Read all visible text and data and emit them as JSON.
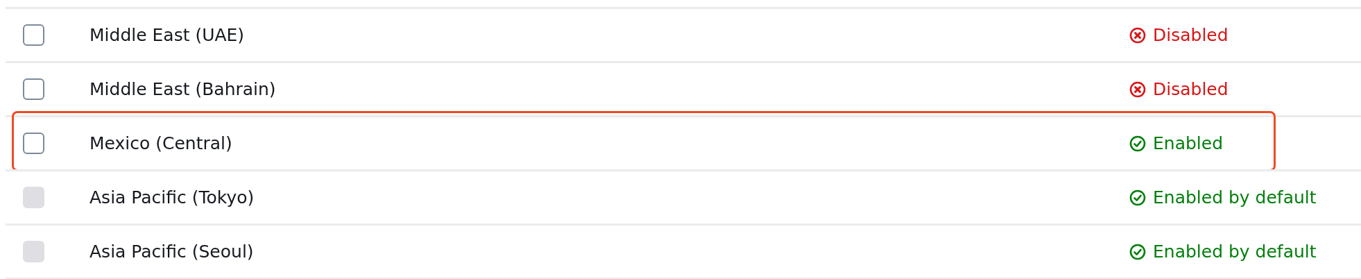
{
  "rows": [
    {
      "name": "Middle East (UAE)",
      "checked": false,
      "disabled": false,
      "highlighted": false,
      "status": {
        "kind": "disabled",
        "label": "Disabled"
      }
    },
    {
      "name": "Middle East (Bahrain)",
      "checked": false,
      "disabled": false,
      "highlighted": false,
      "status": {
        "kind": "disabled",
        "label": "Disabled"
      }
    },
    {
      "name": "Mexico (Central)",
      "checked": false,
      "disabled": false,
      "highlighted": true,
      "status": {
        "kind": "enabled",
        "label": "Enabled"
      }
    },
    {
      "name": "Asia Pacific (Tokyo)",
      "checked": false,
      "disabled": true,
      "highlighted": false,
      "status": {
        "kind": "enabled",
        "label": "Enabled by default"
      }
    },
    {
      "name": "Asia Pacific (Seoul)",
      "checked": false,
      "disabled": true,
      "highlighted": false,
      "status": {
        "kind": "enabled",
        "label": "Enabled by default"
      }
    }
  ]
}
